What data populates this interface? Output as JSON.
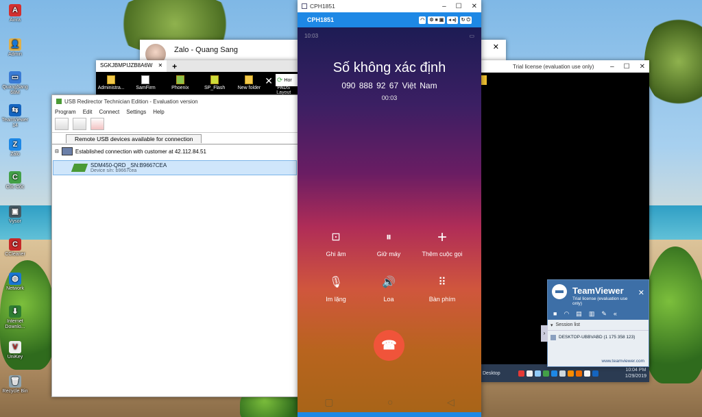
{
  "desktop": {
    "icons": [
      {
        "label": "Avira",
        "icon": "avira-icon",
        "color": "#d32f2f",
        "glyph": "A"
      },
      {
        "label": "Admin",
        "icon": "user-folder-icon",
        "color": "#e0b04a",
        "glyph": "👤"
      },
      {
        "label": "QuangSang 68M",
        "icon": "computer-icon",
        "color": "#3a7bd5",
        "glyph": "▭"
      },
      {
        "label": "TeamViewer 14",
        "icon": "teamviewer-icon",
        "color": "#1565c0",
        "glyph": "⇆"
      },
      {
        "label": "Zalo",
        "icon": "zalo-icon",
        "color": "#1e88e5",
        "glyph": "Z"
      },
      {
        "label": "Cốc Cốc",
        "icon": "coccoc-icon",
        "color": "#43a047",
        "glyph": "C"
      },
      {
        "label": "Vysor",
        "icon": "vysor-icon",
        "color": "#455a64",
        "glyph": "▣"
      },
      {
        "label": "CCleaner",
        "icon": "ccleaner-icon",
        "color": "#c62828",
        "glyph": "C"
      },
      {
        "label": "Network",
        "icon": "network-icon",
        "color": "#1976d2",
        "glyph": "◍"
      },
      {
        "label": "Internet Downlo...",
        "icon": "idm-icon",
        "color": "#2e7d32",
        "glyph": "⬇"
      },
      {
        "label": "UniKey",
        "icon": "unikey-icon",
        "color": "#eeeeee",
        "glyph": "V"
      },
      {
        "label": "Recycle Bin",
        "icon": "recycle-bin-icon",
        "color": "#90a4ae",
        "glyph": "🗑"
      }
    ]
  },
  "zalo": {
    "title": "Zalo - Quang Sang",
    "close": "✕"
  },
  "explorer": {
    "tab_title": "SGKJBMPIJZB8A6W",
    "tab_close": "✕",
    "new_tab": "+",
    "items": [
      "Administra...",
      "SamFirm",
      "Phoenix",
      "SP_Flash",
      "New folder",
      "PADS Layout"
    ],
    "close_label": "✕",
    "home_label": "Hor"
  },
  "usb": {
    "title": "USB Redirector Technician Edition - Evaluation version",
    "menu": [
      "Program",
      "Edit",
      "Connect",
      "Settings",
      "Help"
    ],
    "tab_label": "Remote USB devices available for connection",
    "connection": "Established connection with customer at 42.112.84.51",
    "device_name": "SDM450-QRD _SN:B9667CEA",
    "device_serial": "Device s/n: b9667cea"
  },
  "phone": {
    "window_title": "CPH1851",
    "device_label": "CPH1851",
    "status_time": "10:03",
    "caller": "Số không xác định",
    "number": "090 888 92 67   Việt Nam",
    "timer": "00:03",
    "actions": [
      {
        "label": "Ghi âm",
        "icon": "record-icon",
        "glyph": "⊡"
      },
      {
        "label": "Giữ máy",
        "icon": "hold-icon",
        "glyph": "⏸"
      },
      {
        "label": "Thêm cuộc gọi",
        "icon": "add-call-icon",
        "glyph": "+"
      },
      {
        "label": "Im lặng",
        "icon": "mute-icon",
        "glyph": "🎙"
      },
      {
        "label": "Loa",
        "icon": "speaker-icon",
        "glyph": "🔊"
      },
      {
        "label": "Bàn phím",
        "icon": "keypad-icon",
        "glyph": "⠿"
      }
    ]
  },
  "teamviewer_remote": {
    "title": "Trial license (evaluation use only)",
    "taskbar_label": "Desktop",
    "clock_time": "10:04 PM",
    "clock_date": "1/29/2019"
  },
  "teamviewer_panel": {
    "brand": "TeamViewer",
    "license": "Trial license (evaluation use only)",
    "session_list": "Session list",
    "session_item": "DESKTOP-UBBVABD (1 175 358 123)",
    "url": "www.teamviewer.com"
  },
  "colors": {
    "accent": "#1e88e5",
    "end_call": "#f0543a",
    "teamviewer": "#3d6fa7"
  }
}
